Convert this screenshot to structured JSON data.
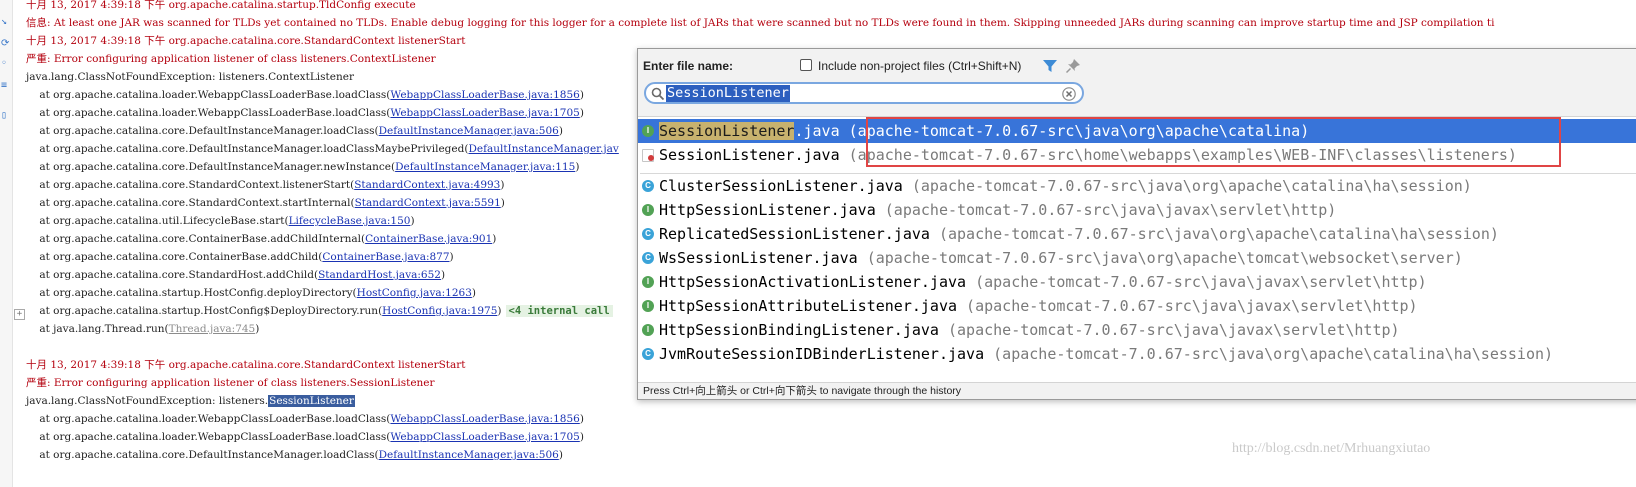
{
  "console": {
    "lines": [
      {
        "cls": "red",
        "text": "十月 13, 2017 4:39:18 下午 org.apache.catalina.startup.TldConfig execute"
      },
      {
        "cls": "red",
        "text": "信息: At least one JAR was scanned for TLDs yet contained no TLDs. Enable debug logging for this logger for a complete list of JARs that were scanned but no TLDs were found in them. Skipping unneeded JARs during scanning can improve startup time and JSP compilation ti"
      },
      {
        "cls": "red",
        "text": "十月 13, 2017 4:39:18 下午 org.apache.catalina.core.StandardContext listenerStart"
      },
      {
        "cls": "red",
        "text": "严重: Error configuring application listener of class listeners.ContextListener"
      },
      {
        "cls": "st",
        "text": "java.lang.ClassNotFoundException: listeners.ContextListener"
      },
      {
        "cls": "st",
        "prefix": "    at org.apache.catalina.loader.WebappClassLoaderBase.loadClass(",
        "link": "WebappClassLoaderBase.java:1856",
        "suffix": ")"
      },
      {
        "cls": "st",
        "prefix": "    at org.apache.catalina.loader.WebappClassLoaderBase.loadClass(",
        "link": "WebappClassLoaderBase.java:1705",
        "suffix": ")"
      },
      {
        "cls": "st",
        "prefix": "    at org.apache.catalina.core.DefaultInstanceManager.loadClass(",
        "link": "DefaultInstanceManager.java:506",
        "suffix": ")"
      },
      {
        "cls": "st",
        "prefix": "    at org.apache.catalina.core.DefaultInstanceManager.loadClassMaybePrivileged(",
        "link": "DefaultInstanceManager.jav",
        "suffix": ""
      },
      {
        "cls": "st",
        "prefix": "    at org.apache.catalina.core.DefaultInstanceManager.newInstance(",
        "link": "DefaultInstanceManager.java:115",
        "suffix": ")"
      },
      {
        "cls": "st",
        "prefix": "    at org.apache.catalina.core.StandardContext.listenerStart(",
        "link": "StandardContext.java:4993",
        "suffix": ")"
      },
      {
        "cls": "st",
        "prefix": "    at org.apache.catalina.core.StandardContext.startInternal(",
        "link": "StandardContext.java:5591",
        "suffix": ")"
      },
      {
        "cls": "st",
        "prefix": "    at org.apache.catalina.util.LifecycleBase.start(",
        "link": "LifecycleBase.java:150",
        "suffix": ")"
      },
      {
        "cls": "st",
        "prefix": "    at org.apache.catalina.core.ContainerBase.addChildInternal(",
        "link": "ContainerBase.java:901",
        "suffix": ")"
      },
      {
        "cls": "st",
        "prefix": "    at org.apache.catalina.core.ContainerBase.addChild(",
        "link": "ContainerBase.java:877",
        "suffix": ")"
      },
      {
        "cls": "st",
        "prefix": "    at org.apache.catalina.core.StandardHost.addChild(",
        "link": "StandardHost.java:652",
        "suffix": ")"
      },
      {
        "cls": "st",
        "prefix": "    at org.apache.catalina.startup.HostConfig.deployDirectory(",
        "link": "HostConfig.java:1263",
        "suffix": ")"
      },
      {
        "cls": "st",
        "prefix": "    at org.apache.catalina.startup.HostConfig$DeployDirectory.run(",
        "link": "HostConfig.java:1975",
        "suffix": ")",
        "badge": "<4 internal call"
      },
      {
        "cls": "st",
        "prefix": "    at java.lang.Thread.run(",
        "link": "Thread.java:745",
        "suffix": ")",
        "grey": true
      },
      {
        "cls": "st",
        "text": ""
      },
      {
        "cls": "red",
        "text": "十月 13, 2017 4:39:18 下午 org.apache.catalina.core.StandardContext listenerStart"
      },
      {
        "cls": "red",
        "text": "严重: Error configuring application listener of class listeners.SessionListener"
      },
      {
        "cls": "st",
        "prefix": "java.lang.ClassNotFoundException: listeners.",
        "selected": "SessionListener"
      },
      {
        "cls": "st",
        "prefix": "    at org.apache.catalina.loader.WebappClassLoaderBase.loadClass(",
        "link": "WebappClassLoaderBase.java:1856",
        "suffix": ")"
      },
      {
        "cls": "st",
        "prefix": "    at org.apache.catalina.loader.WebappClassLoaderBase.loadClass(",
        "link": "WebappClassLoaderBase.java:1705",
        "suffix": ")"
      },
      {
        "cls": "st",
        "prefix": "    at org.apache.catalina.core.DefaultInstanceManager.loadClass(",
        "link": "DefaultInstanceManager.java:506",
        "suffix": ")"
      }
    ]
  },
  "popup": {
    "label": "Enter file name:",
    "include_non_project": false,
    "include_label": "Include non-project files (Ctrl+Shift+N)",
    "filter_icon": "filter-icon",
    "pin_icon": "pin-icon",
    "search_value": "SessionListener",
    "footer": "Press Ctrl+向上箭头 or Ctrl+向下箭头 to navigate through the history",
    "results": [
      {
        "icon": "iface",
        "hl": "SessionListener",
        "rest": ".java",
        "path": "(apache-tomcat-7.0.67-src\\java\\org\\apache\\catalina)",
        "selected": true
      },
      {
        "icon": "jfile",
        "hl": "",
        "rest": "SessionListener.java",
        "path": "(apache-tomcat-7.0.67-src\\home\\webapps\\examples\\WEB-INF\\classes\\listeners)",
        "selected": false
      },
      {
        "icon": "cls",
        "hl": "",
        "rest": "ClusterSessionListener.java",
        "path": "(apache-tomcat-7.0.67-src\\java\\org\\apache\\catalina\\ha\\session)",
        "selected": false
      },
      {
        "icon": "iface",
        "hl": "",
        "rest": "HttpSessionListener.java",
        "path": "(apache-tomcat-7.0.67-src\\java\\javax\\servlet\\http)",
        "selected": false
      },
      {
        "icon": "cls",
        "hl": "",
        "rest": "ReplicatedSessionListener.java",
        "path": "(apache-tomcat-7.0.67-src\\java\\org\\apache\\catalina\\ha\\session)",
        "selected": false
      },
      {
        "icon": "cls",
        "hl": "",
        "rest": "WsSessionListener.java",
        "path": "(apache-tomcat-7.0.67-src\\java\\org\\apache\\tomcat\\websocket\\server)",
        "selected": false
      },
      {
        "icon": "iface",
        "hl": "",
        "rest": "HttpSessionActivationListener.java",
        "path": "(apache-tomcat-7.0.67-src\\java\\javax\\servlet\\http)",
        "selected": false
      },
      {
        "icon": "iface",
        "hl": "",
        "rest": "HttpSessionAttributeListener.java",
        "path": "(apache-tomcat-7.0.67-src\\java\\javax\\servlet\\http)",
        "selected": false
      },
      {
        "icon": "iface",
        "hl": "",
        "rest": "HttpSessionBindingListener.java",
        "path": "(apache-tomcat-7.0.67-src\\java\\javax\\servlet\\http)",
        "selected": false
      },
      {
        "icon": "cls",
        "hl": "",
        "rest": "JvmRouteSessionIDBinderListener.java",
        "path": "(apache-tomcat-7.0.67-src\\java\\org\\apache\\catalina\\ha\\session)",
        "selected": false
      }
    ]
  },
  "watermark": "http://blog.csdn.net/Mrhuangxiutao"
}
